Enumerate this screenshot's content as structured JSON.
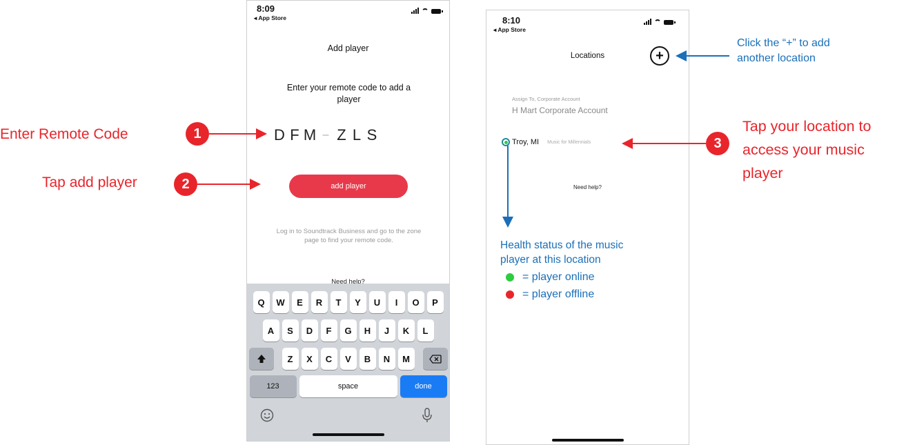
{
  "phone1": {
    "status": {
      "time": "8:09",
      "back": "◂ App Store"
    },
    "title": "Add player",
    "instruction": "Enter your remote code to add a player",
    "code": [
      "D",
      "F",
      "M",
      "Z",
      "L",
      "S"
    ],
    "add_button": "add player",
    "help_text": "Log in to Soundtrack Business and go to the zone page to find your remote code.",
    "need_help": "Need help?",
    "keyboard": {
      "row1": [
        "Q",
        "W",
        "E",
        "R",
        "T",
        "Y",
        "U",
        "I",
        "O",
        "P"
      ],
      "row2": [
        "A",
        "S",
        "D",
        "F",
        "G",
        "H",
        "J",
        "K",
        "L"
      ],
      "row3": [
        "Z",
        "X",
        "C",
        "V",
        "B",
        "N",
        "M"
      ],
      "shift": "shift-icon",
      "backspace": "backspace-icon",
      "numbers": "123",
      "space": "space",
      "done": "done",
      "emoji": "emoji-icon",
      "mic": "microphone-icon"
    }
  },
  "phone2": {
    "status": {
      "time": "8:10",
      "back": "◂ App Store"
    },
    "title": "Locations",
    "plus": "+",
    "assign_label": "Assign To, Corporate Account",
    "account_name": "H Mart Corporate Account",
    "location_name": "Troy, MI",
    "location_playlist": "Music for Millennials",
    "need_help": "Need help?"
  },
  "annotations": {
    "step1_text": "Enter Remote Code",
    "step1_num": "1",
    "step2_text": "Tap add player",
    "step2_num": "2",
    "step3_num": "3",
    "step3_text": [
      "Tap your location to",
      "access your music",
      "player"
    ],
    "plus_note": [
      "Click the “+” to add",
      "another location"
    ],
    "health_title": [
      "Health status of the music",
      "player at this location"
    ],
    "legend_online": "= player online",
    "legend_offline": "= player offline"
  },
  "colors": {
    "annotation_red": "#e8252b",
    "annotation_blue": "#1a6fb8",
    "button_red": "#e8394a",
    "done_blue": "#1a7cf5",
    "online_green": "#2ecc40",
    "offline_red": "#e8252b"
  }
}
